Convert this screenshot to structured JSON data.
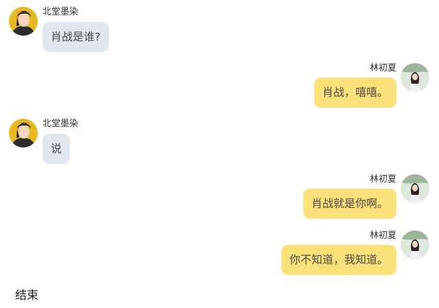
{
  "messages": [
    {
      "side": "left",
      "sender": "北堂墨染",
      "text": "肖战是谁?"
    },
    {
      "side": "right",
      "sender": "林初夏",
      "text": "肖战，嘻嘻。"
    },
    {
      "side": "left",
      "sender": "北堂墨染",
      "text": "说"
    },
    {
      "side": "right",
      "sender": "林初夏",
      "text": "肖战就是你啊。"
    },
    {
      "side": "right",
      "sender": "林初夏",
      "text": "你不知道，我知道。"
    }
  ],
  "footer": {
    "text": "结束"
  },
  "colors": {
    "left_bubble": "#e1e7ef",
    "right_bubble": "#fce07a"
  },
  "icons": {
    "left_avatar": "male-character-avatar",
    "right_avatar": "female-character-avatar"
  }
}
